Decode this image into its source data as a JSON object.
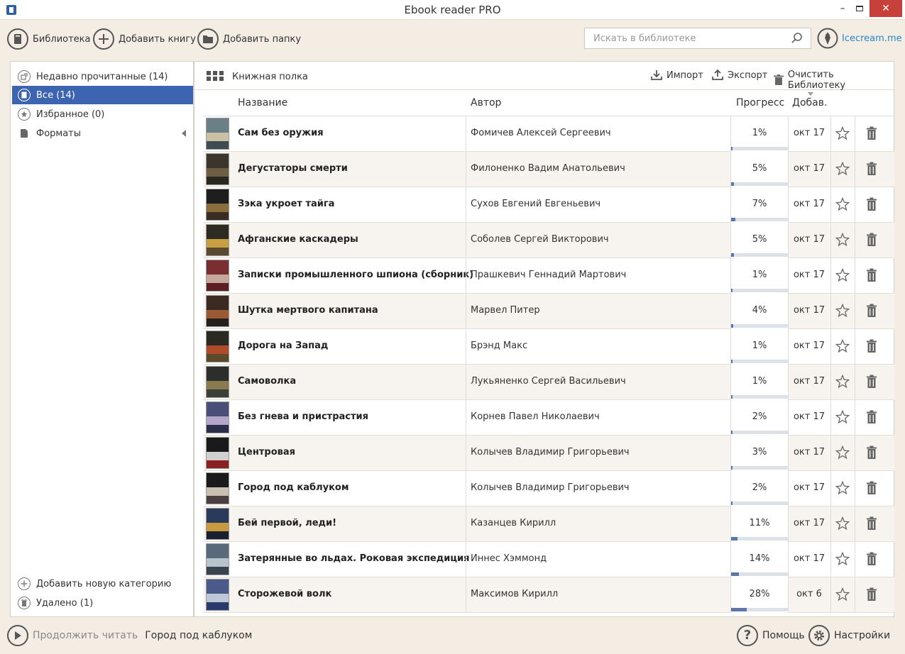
{
  "window": {
    "title": "Ebook reader PRO",
    "min_label": "–",
    "close_label": "✕"
  },
  "toolbar": {
    "library_label": "Библиотека",
    "add_book_label": "Добавить книгу",
    "add_folder_label": "Добавить папку",
    "search_placeholder": "Искать в библиотеке",
    "brand_link": "Icecream.me"
  },
  "sidebar": {
    "categories": [
      {
        "label": "Недавно прочитанные (14)",
        "icon": "recent-icon"
      },
      {
        "label": "Все (14)",
        "icon": "book-icon",
        "active": true
      },
      {
        "label": "Избранное (0)",
        "icon": "star-icon"
      },
      {
        "label": "Форматы",
        "icon": "file-icon"
      }
    ],
    "add_category_label": "Добавить новую категорию",
    "deleted_label": "Удалено (1)"
  },
  "main": {
    "view_label": "Книжная полка",
    "import_label": "Импорт",
    "export_label": "Экспорт",
    "clear_label": "Очистить Библиотеку",
    "columns": {
      "title": "Название",
      "author": "Автор",
      "progress": "Прогресс",
      "added": "Добав."
    },
    "books": [
      {
        "title": "Сам без оружия",
        "author": "Фомичев Алексей Сергеевич",
        "progress_label": "1%",
        "progress": 1,
        "added": "окт 17",
        "cover": [
          "#6b7f86",
          "#c9c1a3",
          "#3d4b52"
        ]
      },
      {
        "title": "Дегустаторы смерти",
        "author": "Филоненко Вадим Анатольевич",
        "progress_label": "5%",
        "progress": 5,
        "added": "окт 17",
        "cover": [
          "#3b352b",
          "#6e5f44",
          "#2a2620"
        ]
      },
      {
        "title": "Зэка укроет тайга",
        "author": "Сухов Евгений Евгеньевич",
        "progress_label": "7%",
        "progress": 7,
        "added": "окт 17",
        "cover": [
          "#1e1e1e",
          "#8a6f3d",
          "#3a2d22"
        ]
      },
      {
        "title": "Афганские каскадеры",
        "author": "Соболев Сергей Викторович",
        "progress_label": "5%",
        "progress": 5,
        "added": "окт 17",
        "cover": [
          "#2e2b22",
          "#c8a042",
          "#5a4a30"
        ]
      },
      {
        "title": "Записки промышленного шпиона (сборник)",
        "author": "Прашкевич Геннадий Мартович",
        "progress_label": "1%",
        "progress": 1,
        "added": "окт 17",
        "cover": [
          "#7a2e32",
          "#c7a79a",
          "#5b1f24"
        ]
      },
      {
        "title": "Шутка мертвого капитана",
        "author": "Марвел Питер",
        "progress_label": "4%",
        "progress": 4,
        "added": "окт 17",
        "cover": [
          "#3a2a22",
          "#9a5a34",
          "#24201c"
        ]
      },
      {
        "title": "Дорога на Запад",
        "author": "Брэнд Макс",
        "progress_label": "1%",
        "progress": 1,
        "added": "окт 17",
        "cover": [
          "#2a2a22",
          "#b04a2a",
          "#5a4a2a"
        ]
      },
      {
        "title": "Самоволка",
        "author": "Лукьяненко Сергей Васильевич",
        "progress_label": "1%",
        "progress": 1,
        "added": "окт 17",
        "cover": [
          "#2b2e2a",
          "#8a7a50",
          "#3a4038"
        ]
      },
      {
        "title": "Без гнева и пристрастия",
        "author": "Корнев Павел Николаевич",
        "progress_label": "2%",
        "progress": 2,
        "added": "окт 17",
        "cover": [
          "#4a4f7a",
          "#b4a6c8",
          "#2a2e48"
        ]
      },
      {
        "title": "Центровая",
        "author": "Колычев Владимир Григорьевич",
        "progress_label": "3%",
        "progress": 3,
        "added": "окт 17",
        "cover": [
          "#1a1a1a",
          "#d0d0d0",
          "#8a2020"
        ]
      },
      {
        "title": "Город под каблуком",
        "author": "Колычев Владимир Григорьевич",
        "progress_label": "2%",
        "progress": 2,
        "added": "окт 17",
        "cover": [
          "#1a1a1a",
          "#c8c0b0",
          "#4a4040"
        ]
      },
      {
        "title": "Бей первой, леди!",
        "author": "Казанцев Кирилл",
        "progress_label": "11%",
        "progress": 11,
        "added": "окт 17",
        "cover": [
          "#2a3a5a",
          "#c89a40",
          "#1a2030"
        ]
      },
      {
        "title": "Затерянные во льдах. Роковая экспедиция",
        "author": "Иннес   Хэммонд",
        "progress_label": "14%",
        "progress": 14,
        "added": "окт 17",
        "cover": [
          "#5a6a7a",
          "#b8c4cc",
          "#3a4450"
        ]
      },
      {
        "title": "Сторожевой волк",
        "author": "Максимов Кирилл",
        "progress_label": "28%",
        "progress": 28,
        "added": "окт 6",
        "cover": [
          "#4a5a8a",
          "#c0c8d8",
          "#2a3a6a"
        ]
      }
    ]
  },
  "status": {
    "continue_label": "Продолжить читать",
    "current_book": "Город под каблуком",
    "help_label": "Помощь",
    "settings_label": "Настройки"
  },
  "colors": {
    "accent": "#3c64b1",
    "progress": "#5b77a8",
    "link": "#2a86c8"
  }
}
